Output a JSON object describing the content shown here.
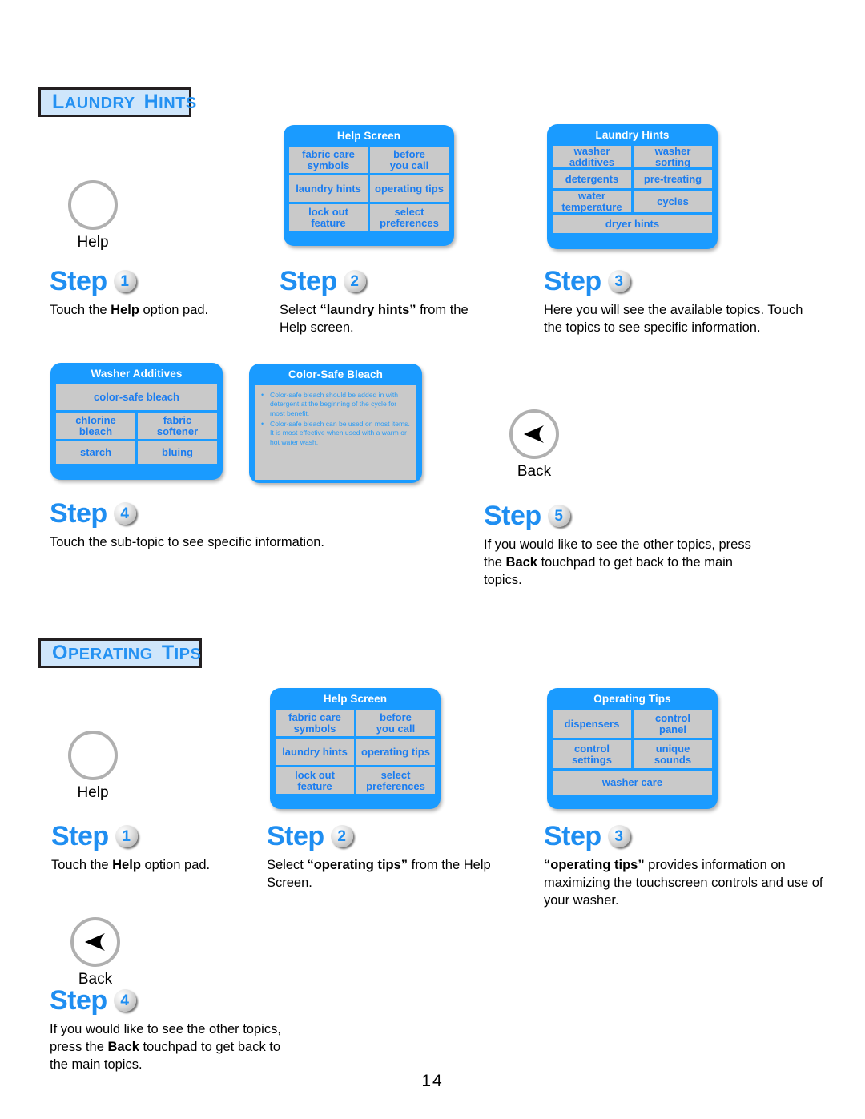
{
  "page": {
    "number": "14"
  },
  "sections": [
    {
      "title_first": "L",
      "title_rest": "AUNDRY",
      "title_first2": "H",
      "title_rest2": "INTS",
      "title_full": "LAUNDRY HINTS"
    },
    {
      "title_first": "O",
      "title_rest": "PERATING",
      "title_first2": "T",
      "title_rest2": "IPS",
      "title_full": "OPERATING TIPS"
    }
  ],
  "pads": {
    "help_label": "Help",
    "back_label": "Back"
  },
  "screens": {
    "help_screen": {
      "title": "Help Screen",
      "rows": [
        [
          {
            "line1": "fabric care",
            "line2": "symbols"
          },
          {
            "line1": "before",
            "line2": "you call"
          }
        ],
        [
          {
            "line1": "laundry hints",
            "line2": ""
          },
          {
            "line1": "operating tips",
            "line2": ""
          }
        ],
        [
          {
            "line1": "lock out",
            "line2": "feature"
          },
          {
            "line1": "select",
            "line2": "preferences"
          }
        ]
      ]
    },
    "laundry_hints": {
      "title": "Laundry Hints",
      "rows": [
        [
          {
            "line1": "washer",
            "line2": "additives"
          },
          {
            "line1": "washer",
            "line2": "sorting"
          }
        ],
        [
          {
            "line1": "detergents",
            "line2": ""
          },
          {
            "line1": "pre-treating",
            "line2": ""
          }
        ],
        [
          {
            "line1": "water",
            "line2": "temperature"
          },
          {
            "line1": "cycles",
            "line2": ""
          }
        ],
        [
          {
            "line1": "dryer hints",
            "line2": ""
          }
        ]
      ]
    },
    "washer_additives": {
      "title": "Washer Additives",
      "rows": [
        [
          {
            "line1": "color-safe bleach",
            "line2": ""
          }
        ],
        [
          {
            "line1": "chlorine",
            "line2": "bleach"
          },
          {
            "line1": "fabric",
            "line2": "softener"
          }
        ],
        [
          {
            "line1": "starch",
            "line2": ""
          },
          {
            "line1": "bluing",
            "line2": ""
          }
        ]
      ]
    },
    "color_safe_bleach": {
      "title": "Color-Safe Bleach",
      "bullets": [
        "Color-safe bleach should be added in with detergent at the beginning of the cycle for most benefit.",
        "Color-safe bleach can be used on most items. It is most effective when used with a warm or hot water wash."
      ]
    },
    "operating_tips": {
      "title": "Operating Tips",
      "rows": [
        [
          {
            "line1": "dispensers",
            "line2": ""
          },
          {
            "line1": "control",
            "line2": "panel"
          }
        ],
        [
          {
            "line1": "control",
            "line2": "settings"
          },
          {
            "line1": "unique",
            "line2": "sounds"
          }
        ],
        [
          {
            "line1": "washer care",
            "line2": ""
          }
        ]
      ]
    }
  },
  "laundry_steps": [
    {
      "word": "Step",
      "num": "1",
      "text_parts": [
        {
          "t": "Touch the ",
          "b": false
        },
        {
          "t": "Help",
          "b": true
        },
        {
          "t": " option pad.",
          "b": false
        }
      ]
    },
    {
      "word": "Step",
      "num": "2",
      "text_parts": [
        {
          "t": "Select ",
          "b": false
        },
        {
          "t": "“laundry hints”",
          "b": true
        },
        {
          "t": " from the Help screen.",
          "b": false
        }
      ]
    },
    {
      "word": "Step",
      "num": "3",
      "text_parts": [
        {
          "t": "Here you will see the available topics. Touch the topics to see specific information.",
          "b": false
        }
      ]
    },
    {
      "word": "Step",
      "num": "4",
      "text_parts": [
        {
          "t": "Touch the sub-topic to see specific information.",
          "b": false
        }
      ]
    },
    {
      "word": "Step",
      "num": "5",
      "text_parts": [
        {
          "t": "If you would like to see the other topics, press the ",
          "b": false
        },
        {
          "t": "Back",
          "b": true
        },
        {
          "t": " touchpad to get back to the main topics.",
          "b": false
        }
      ]
    }
  ],
  "operating_steps": [
    {
      "word": "Step",
      "num": "1",
      "text_parts": [
        {
          "t": "Touch the ",
          "b": false
        },
        {
          "t": "Help",
          "b": true
        },
        {
          "t": " option pad.",
          "b": false
        }
      ]
    },
    {
      "word": "Step",
      "num": "2",
      "text_parts": [
        {
          "t": "Select ",
          "b": false
        },
        {
          "t": "“operating tips”",
          "b": true
        },
        {
          "t": " from the Help Screen.",
          "b": false
        }
      ]
    },
    {
      "word": "Step",
      "num": "3",
      "text_parts": [
        {
          "t": "“operating tips”",
          "b": true
        },
        {
          "t": " provides information on maximizing the touchscreen controls and use of your washer.",
          "b": false
        }
      ]
    },
    {
      "word": "Step",
      "num": "4",
      "text_parts": [
        {
          "t": "If you would like to see the other topics, press the ",
          "b": false
        },
        {
          "t": "Back",
          "b": true
        },
        {
          "t": " touchpad to get back to the main topics.",
          "b": false
        }
      ]
    }
  ],
  "colors": {
    "accent_blue": "#1f8ef1",
    "screen_blue": "#1a9bff",
    "cell_gray": "#c9c9c9",
    "banner_bg": "#cfe6fb"
  }
}
